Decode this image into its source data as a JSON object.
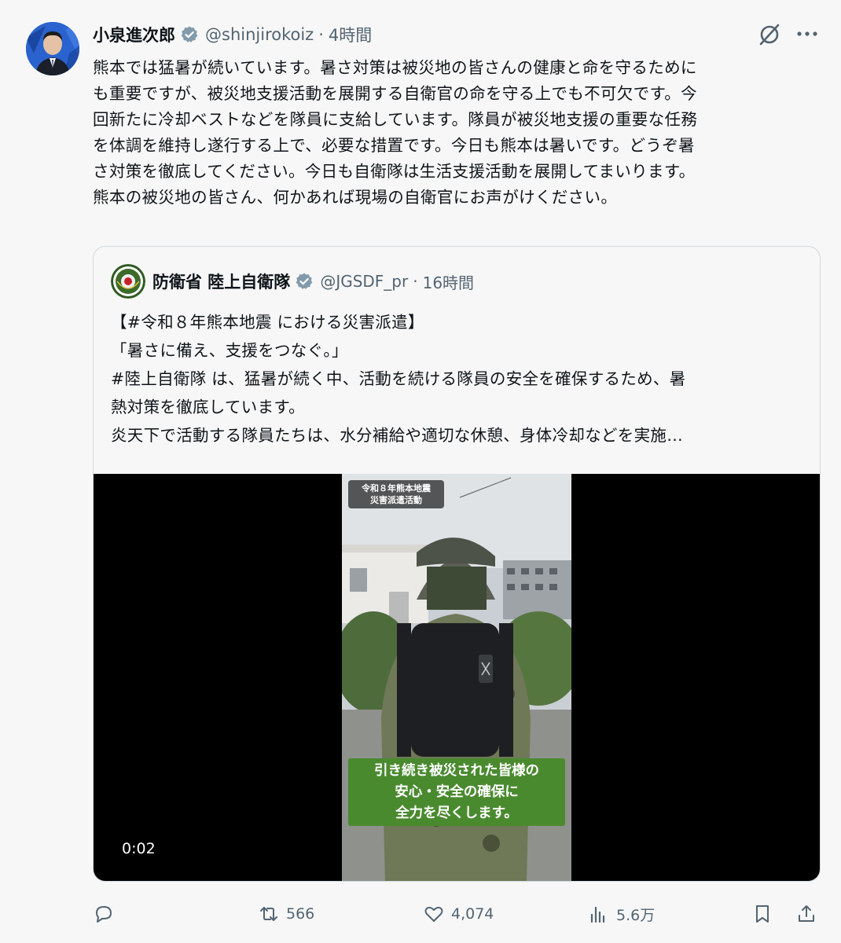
{
  "author": {
    "name": "小泉進次郎",
    "handle": "@shinjirokoiz",
    "separator": "·",
    "time": "4時間"
  },
  "post": {
    "lines": [
      "熊本では猛暑が続いています。暑さ対策は被災地の皆さんの健康と命を守るために",
      "も重要ですが、被災地支援活動を展開する自衛官の命を守る上でも不可欠です。今",
      "回新たに冷却ベストなどを隊員に支給しています。隊員が被災地支援の重要な任務",
      "を体調を維持し遂行する上で、必要な措置です。今日も熊本は暑いです。どうぞ暑",
      "さ対策を徹底してください。今日も自衛隊は生活支援活動を展開してまいります。",
      "熊本の被災地の皆さん、何かあれば現場の自衛官にお声がけください。"
    ]
  },
  "quote": {
    "name": "防衛省 陸上自衛隊",
    "handle": "@JGSDF_pr",
    "separator": "·",
    "time": "16時間",
    "lines": [
      "【#令和８年熊本地震 における災害派遣】",
      "「暑さに備え、支援をつなぐ。」",
      "#陸上自衛隊 は、猛暑が続く中、活動を続ける隊員の安全を確保するため、暑",
      "熱対策を徹底しています。",
      "炎天下で活動する隊員たちは、水分補給や適切な休憩、身体冷却などを実施…"
    ],
    "video": {
      "label_top": [
        "令和８年熊本地震",
        "災害派遣活動"
      ],
      "caption": [
        "引き続き被災された皆様の",
        "安心・安全の確保に",
        "全力を尽くします。"
      ],
      "timestamp": "0:02"
    }
  },
  "actions": {
    "reply": {
      "icon": "reply-icon",
      "count": ""
    },
    "repost": {
      "icon": "repost-icon",
      "count": "566"
    },
    "like": {
      "icon": "heart-icon",
      "count": "4,074"
    },
    "views": {
      "icon": "views-icon",
      "count": "5.6万"
    },
    "bookmark": {
      "icon": "bookmark-icon"
    },
    "share": {
      "icon": "share-icon"
    }
  },
  "colors": {
    "text": "#0f1419",
    "secondary": "#536471",
    "verified": "#829aab",
    "caption_bg": "#4a8a2f",
    "background": "#f7f7f7"
  }
}
